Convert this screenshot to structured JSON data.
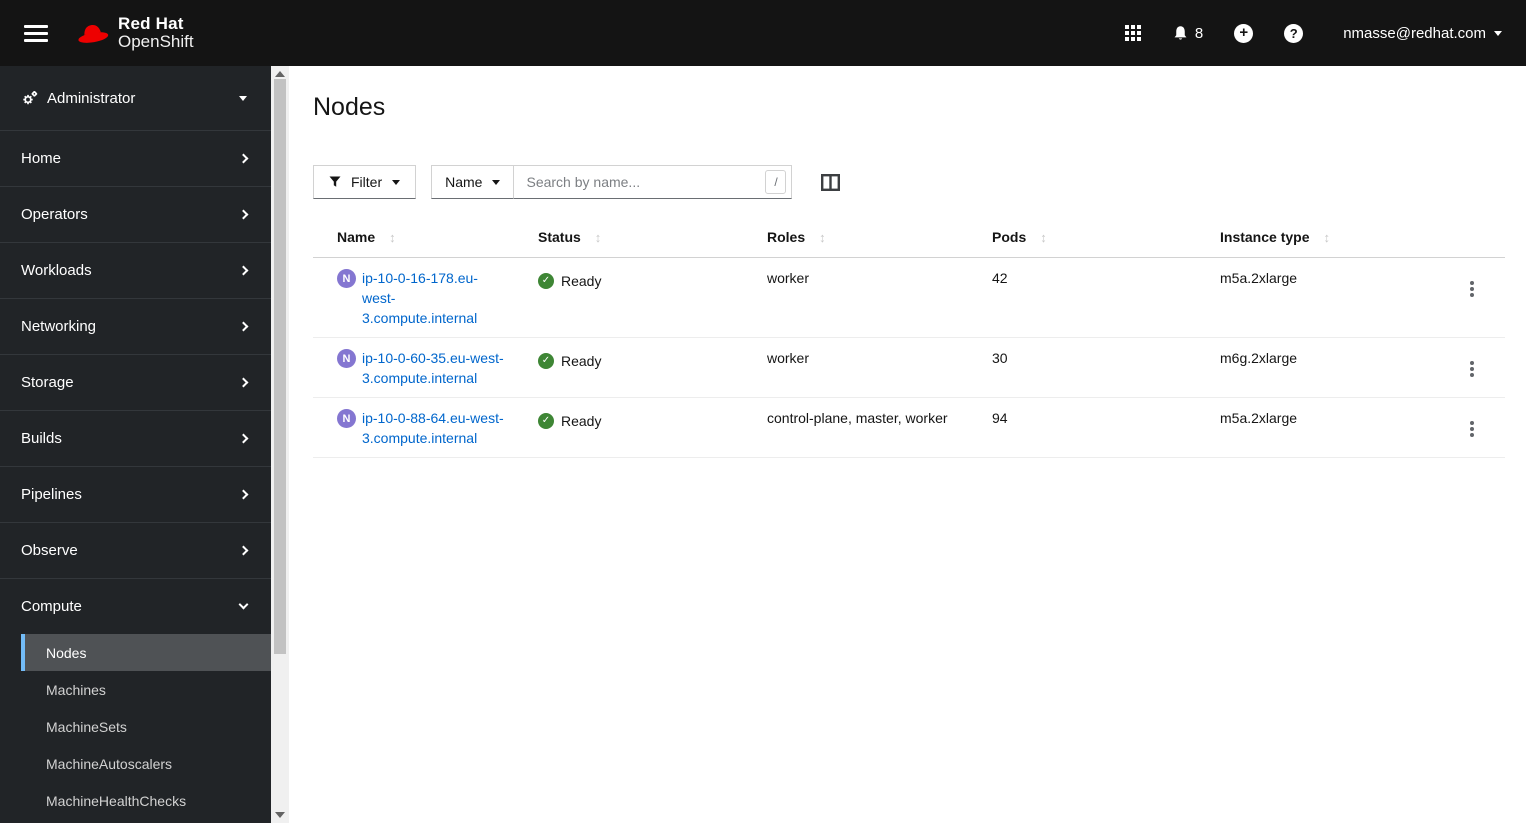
{
  "masthead": {
    "brand_line1": "Red Hat",
    "brand_line2": "OpenShift",
    "notification_count": "8",
    "user_menu": "nmasse@redhat.com"
  },
  "sidebar": {
    "perspective": "Administrator",
    "items": [
      "Home",
      "Operators",
      "Workloads",
      "Networking",
      "Storage",
      "Builds",
      "Pipelines",
      "Observe"
    ],
    "compute": {
      "label": "Compute",
      "children": [
        "Nodes",
        "Machines",
        "MachineSets",
        "MachineAutoscalers",
        "MachineHealthChecks"
      ],
      "selected": "Nodes"
    }
  },
  "page": {
    "title": "Nodes",
    "toolbar": {
      "filter_label": "Filter",
      "filter_attribute": "Name",
      "search_placeholder": "Search by name...",
      "search_shortcut": "/"
    },
    "table": {
      "columns": [
        "Name",
        "Status",
        "Roles",
        "Pods",
        "Instance type"
      ],
      "resource_badge": "N",
      "rows": [
        {
          "name": "ip-10-0-16-178.eu-west-3.compute.internal",
          "status": "Ready",
          "roles": "worker",
          "pods": "42",
          "instance_type": "m5a.2xlarge"
        },
        {
          "name": "ip-10-0-60-35.eu-west-3.compute.internal",
          "status": "Ready",
          "roles": "worker",
          "pods": "30",
          "instance_type": "m6g.2xlarge"
        },
        {
          "name": "ip-10-0-88-64.eu-west-3.compute.internal",
          "status": "Ready",
          "roles": "control-plane, master, worker",
          "pods": "94",
          "instance_type": "m5a.2xlarge"
        }
      ]
    }
  },
  "icons": {
    "sort": "↕",
    "ready_check": "✓",
    "plus": "+",
    "question": "?"
  },
  "colors": {
    "brand_red": "#ee0000",
    "accent_blue": "#73bcf7",
    "link_blue": "#0066cc",
    "success_green": "#3e8635",
    "node_badge_purple": "#8476d1"
  }
}
